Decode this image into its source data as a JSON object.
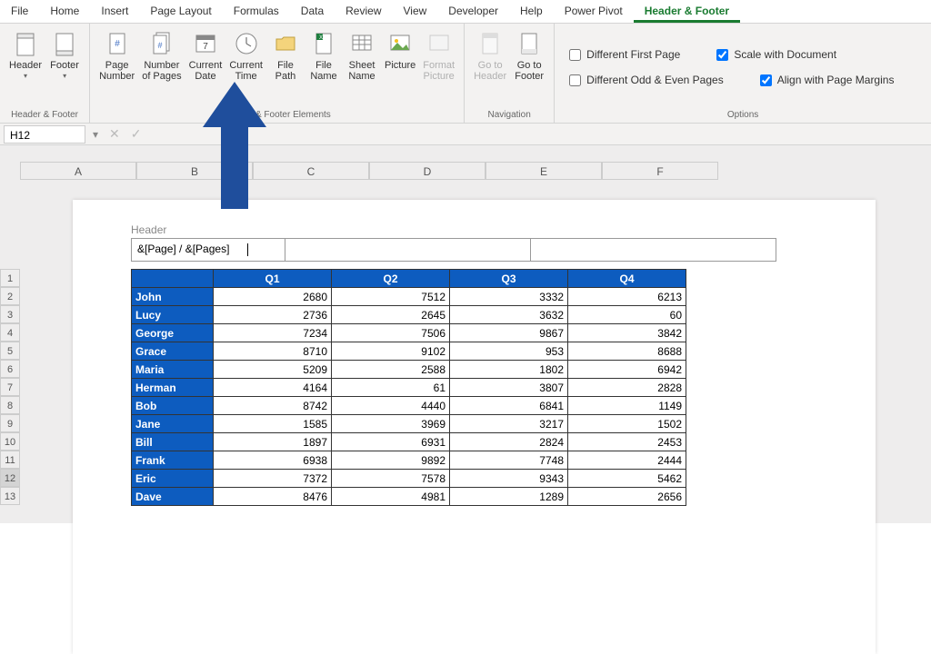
{
  "tabs": [
    "File",
    "Home",
    "Insert",
    "Page Layout",
    "Formulas",
    "Data",
    "Review",
    "View",
    "Developer",
    "Help",
    "Power Pivot",
    "Header & Footer"
  ],
  "activeTab": "Header & Footer",
  "ribbon": {
    "hf": {
      "header": "Header",
      "footer": "Footer",
      "label": "Header & Footer"
    },
    "elems": {
      "pageNumber": "Page\nNumber",
      "numPages": "Number\nof Pages",
      "curDate": "Current\nDate",
      "curTime": "Current\nTime",
      "filePath": "File\nPath",
      "fileName": "File\nName",
      "sheetName": "Sheet\nName",
      "picture": "Picture",
      "formatPicture": "Format\nPicture",
      "label": "Header & Footer Elements"
    },
    "nav": {
      "gotoHeader": "Go to\nHeader",
      "gotoFooter": "Go to\nFooter",
      "label": "Navigation"
    },
    "options": {
      "diffFirst": "Different First Page",
      "diffOddEven": "Different Odd & Even Pages",
      "scaleDoc": "Scale with Document",
      "alignMargins": "Align with Page Margins",
      "label": "Options"
    }
  },
  "nameBox": "H12",
  "headerLabel": "Header",
  "headerText": "&[Page] / &[Pages]",
  "columns": [
    "A",
    "B",
    "C",
    "D",
    "E",
    "F"
  ],
  "rows": [
    1,
    2,
    3,
    4,
    5,
    6,
    7,
    8,
    9,
    10,
    11,
    12,
    13
  ],
  "selectedRow": 12,
  "chart_data": {
    "type": "table",
    "title": "",
    "columns": [
      "",
      "Q1",
      "Q2",
      "Q3",
      "Q4"
    ],
    "data": [
      [
        "John",
        2680,
        7512,
        3332,
        6213
      ],
      [
        "Lucy",
        2736,
        2645,
        3632,
        60
      ],
      [
        "George",
        7234,
        7506,
        9867,
        3842
      ],
      [
        "Grace",
        8710,
        9102,
        953,
        8688
      ],
      [
        "Maria",
        5209,
        2588,
        1802,
        6942
      ],
      [
        "Herman",
        4164,
        61,
        3807,
        2828
      ],
      [
        "Bob",
        8742,
        4440,
        6841,
        1149
      ],
      [
        "Jane",
        1585,
        3969,
        3217,
        1502
      ],
      [
        "Bill",
        1897,
        6931,
        2824,
        2453
      ],
      [
        "Frank",
        6938,
        9892,
        7748,
        2444
      ],
      [
        "Eric",
        7372,
        7578,
        9343,
        5462
      ],
      [
        "Dave",
        8476,
        4981,
        1289,
        2656
      ]
    ]
  }
}
